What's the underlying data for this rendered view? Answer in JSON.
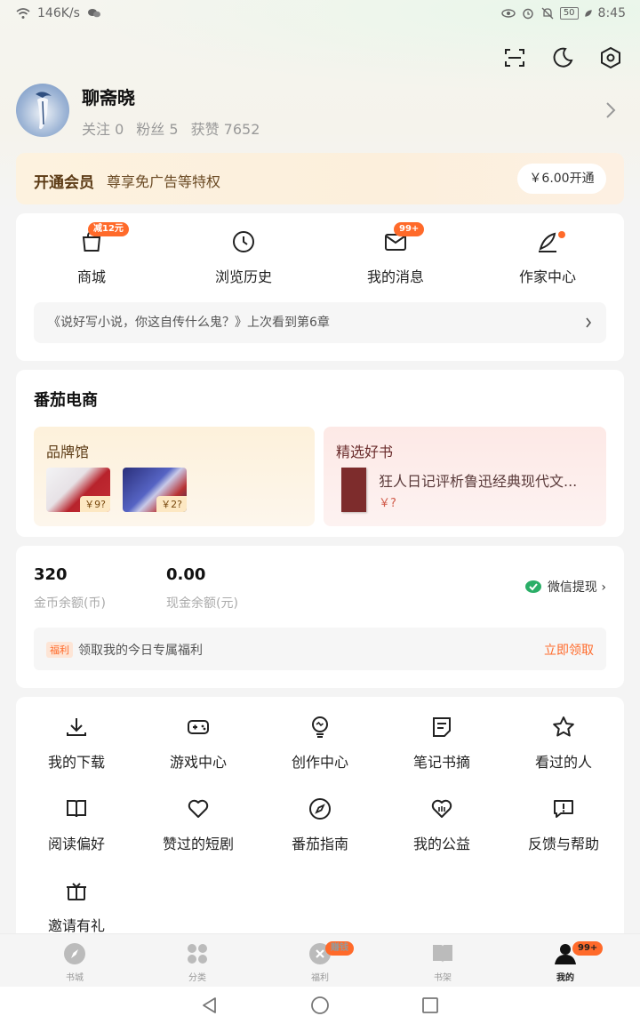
{
  "status_bar": {
    "speed": "146K/s",
    "battery": "50",
    "time": "8:45"
  },
  "header_icons": [
    "scan-icon",
    "moon-icon",
    "settings-icon"
  ],
  "profile": {
    "name": "聊斋晓",
    "follow": "关注 0",
    "fans": "粉丝 5",
    "likes": "获赞 7652"
  },
  "vip": {
    "title": "开通会员",
    "subtitle": "尊享免广告等特权",
    "button": "￥6.00开通"
  },
  "quick_actions": [
    {
      "label": "商城",
      "badge": "减12元",
      "icon": "shop-icon"
    },
    {
      "label": "浏览历史",
      "icon": "clock-icon"
    },
    {
      "label": "我的消息",
      "badge": "99+",
      "icon": "mail-icon"
    },
    {
      "label": "作家中心",
      "icon": "pen-icon"
    }
  ],
  "history_text": "《说好写小说，你这自传什么鬼？》上次看到第6章",
  "ecommerce": {
    "title": "番茄电商",
    "brand": {
      "title": "品牌馆",
      "products": [
        {
          "price": "￥9?"
        },
        {
          "price": "￥2?"
        }
      ]
    },
    "pick": {
      "title": "精选好书",
      "book_name": "狂人日记评析鲁迅经典现代文...",
      "book_price": "￥?"
    }
  },
  "balance": {
    "coins": "320",
    "coins_label": "金币余额(币)",
    "cash": "0.00",
    "cash_label": "现金余额(元)",
    "wechat": "微信提现 ›",
    "welfare_tag": "福利",
    "welfare_text": "领取我的今日专属福利",
    "welfare_button": "立即领取"
  },
  "grid_items": [
    {
      "label": "我的下载",
      "icon": "download-icon"
    },
    {
      "label": "游戏中心",
      "icon": "gamepad-icon"
    },
    {
      "label": "创作中心",
      "icon": "bulb-icon"
    },
    {
      "label": "笔记书摘",
      "icon": "note-icon"
    },
    {
      "label": "看过的人",
      "icon": "star-icon"
    },
    {
      "label": "阅读偏好",
      "icon": "book-icon"
    },
    {
      "label": "赞过的短剧",
      "icon": "heart-icon"
    },
    {
      "label": "番茄指南",
      "icon": "compass-icon"
    },
    {
      "label": "我的公益",
      "icon": "charity-icon"
    },
    {
      "label": "反馈与帮助",
      "icon": "feedback-icon"
    },
    {
      "label": "邀请有礼",
      "icon": "gift-icon"
    }
  ],
  "bottom_nav": [
    {
      "label": "书城",
      "icon": "compass-nav-icon"
    },
    {
      "label": "分类",
      "icon": "category-icon"
    },
    {
      "label": "福利",
      "icon": "welfare-icon",
      "badge": "赚钱"
    },
    {
      "label": "书架",
      "icon": "bookshelf-icon"
    },
    {
      "label": "我的",
      "icon": "profile-icon",
      "badge": "99+",
      "active": true
    }
  ],
  "colors": {
    "accent": "#ff6a2a",
    "vip_text": "#5b3a14",
    "wechat_green": "#2aae67"
  }
}
